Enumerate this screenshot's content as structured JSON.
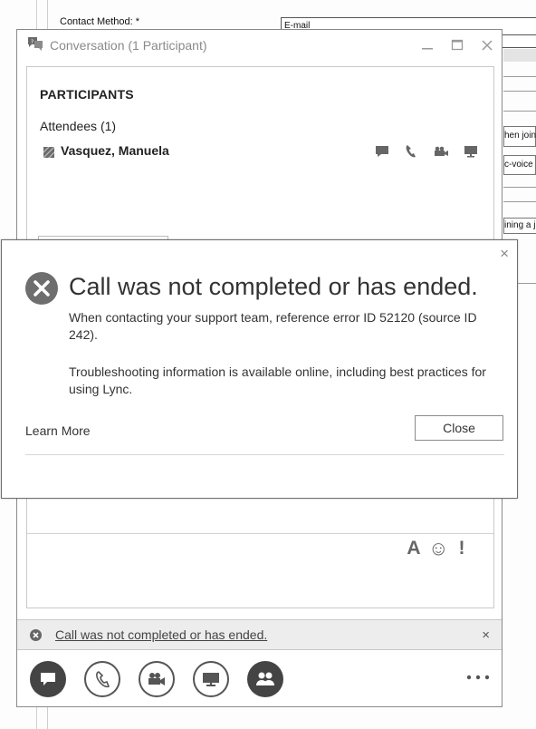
{
  "background_form": {
    "contact_method_label": "Contact Method: *",
    "contact_method_value": "E-mail",
    "right_snippets": [
      "hen join",
      "c-voice",
      "ining a j"
    ]
  },
  "conversation": {
    "title": "Conversation (1 Participant)",
    "participants_heading": "PARTICIPANTS",
    "attendees_label": "Attendees (1)",
    "attendee_name": "Vasquez, Manuela",
    "compose_font_icon": "A",
    "compose_emoji_icon": "☺",
    "compose_priority_icon": "!",
    "notification_text": "Call was not completed or has ended.",
    "notification_close": "×"
  },
  "dialog": {
    "title": "Call was not completed or has ended.",
    "message_1": "When contacting your support team, reference error ID 52120 (source ID 242).",
    "message_2": "Troubleshooting information is available online, including best practices for using Lync.",
    "learn_more": "Learn More",
    "close_label": "Close",
    "close_x": "×"
  },
  "icons": {
    "title_icon": "conversation-icon",
    "attendee_actions": [
      "im-icon",
      "phone-icon",
      "video-icon",
      "screen-share-icon"
    ],
    "toolbar": [
      "im-icon",
      "phone-icon",
      "video-icon",
      "screen-share-icon",
      "participants-icon",
      "more-options-icon"
    ],
    "error_icon": "error-circle-icon"
  },
  "colors": {
    "toolbar_filled": "#444444",
    "notification_bg": "#ededed",
    "dialog_text": "#333333",
    "title_gray": "#8a8a8a"
  }
}
